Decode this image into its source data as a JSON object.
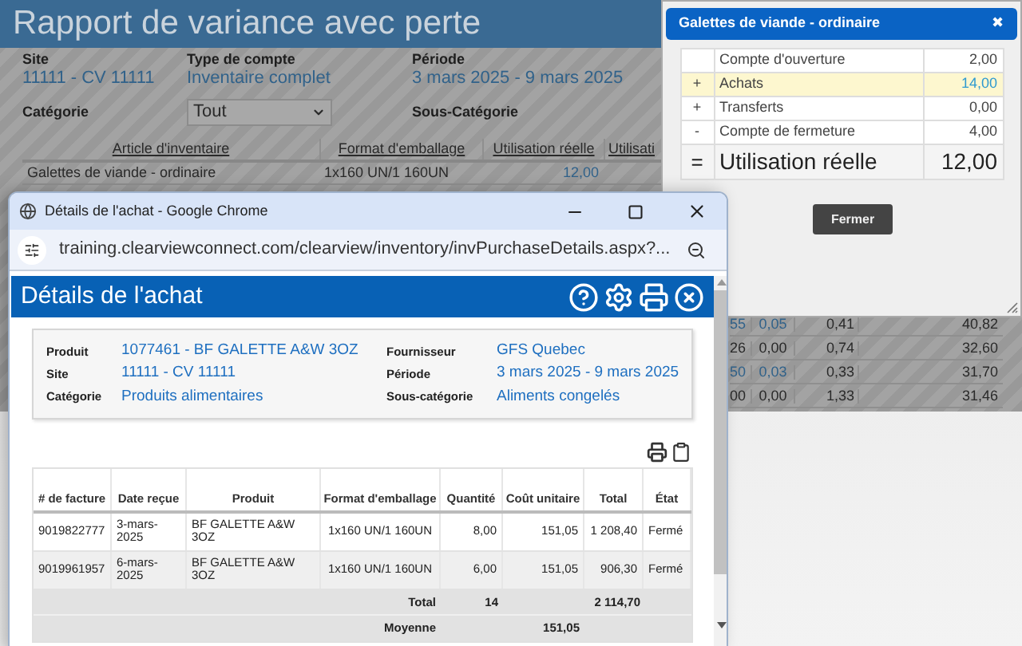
{
  "report": {
    "title": "Rapport de variance avec perte",
    "fields": [
      {
        "label": "Site",
        "value": "11111 - CV 11111"
      },
      {
        "label": "Type de compte",
        "value": "Inventaire complet"
      },
      {
        "label": "Période",
        "value": "3 mars 2025 - 9 mars 2025"
      }
    ],
    "category": {
      "label": "Catégorie",
      "value": "Tout"
    },
    "subcategory": {
      "label": "Sous-Catégorie"
    },
    "table": {
      "columns": [
        "Article d'inventaire",
        "Format d'emballage",
        "Utilisation réelle",
        "Utilisati"
      ],
      "rows": [
        {
          "item": "Galettes de viande - ordinaire",
          "format": "1x160 UN/1 160UN",
          "usage": "12,00"
        }
      ]
    },
    "lower_rows": [
      {
        "column_1": "55",
        "column_2": "0,05",
        "column_3": "0,41",
        "column_4": "40,82",
        "linked": true
      },
      {
        "column_1": "26",
        "column_2": "0,00",
        "column_3": "0,74",
        "column_4": "32,60",
        "linked": false
      },
      {
        "column_1": "50",
        "column_2": "0,03",
        "column_3": "0,33",
        "column_4": "31,70",
        "linked": true
      },
      {
        "column_1": "00",
        "column_2": "0,00",
        "column_3": "1,33",
        "column_4": "31,46",
        "linked": false
      }
    ]
  },
  "summary_dialog": {
    "title": "Galettes de viande - ordinaire",
    "close": "✖",
    "rows": [
      {
        "sign": "",
        "label": "Compte d'ouverture",
        "value": "2,00",
        "selected": false
      },
      {
        "sign": "+",
        "label": "Achats",
        "value": "14,00",
        "selected": true
      },
      {
        "sign": "+",
        "label": "Transferts",
        "value": "0,00",
        "selected": false
      },
      {
        "sign": "-",
        "label": "Compte de fermeture",
        "value": "4,00",
        "selected": false
      }
    ],
    "total": {
      "sign": "=",
      "label": "Utilisation réelle",
      "value": "12,00"
    },
    "button": "Fermer"
  },
  "browser_window": {
    "title": "Détails de l'achat - Google Chrome",
    "url": "training.clearviewconnect.com/clearview/inventory/invPurchaseDetails.aspx?...",
    "page": {
      "title": "Détails de l'achat",
      "info": [
        {
          "label": "Produit",
          "value": "1077461 - BF GALETTE A&W 3OZ"
        },
        {
          "label": "Fournisseur",
          "value": "GFS Quebec"
        },
        {
          "label": "Site",
          "value": "11111 - CV 11111"
        },
        {
          "label": "Période",
          "value": "3 mars 2025 - 9 mars 2025"
        },
        {
          "label": "Catégorie",
          "value": "Produits alimentaires"
        },
        {
          "label": "Sous-catégorie",
          "value": "Aliments congelés"
        }
      ],
      "table": {
        "columns": [
          "# de facture",
          "Date reçue",
          "Produit",
          "Format d'emballage",
          "Quantité",
          "Coût unitaire",
          "Total",
          "État"
        ],
        "rows": [
          [
            "9019822777",
            "3-mars-2025",
            "BF GALETTE A&W 3OZ",
            "1x160 UN/1 160UN",
            "8,00",
            "151,05",
            "1 208,40",
            "Fermé"
          ],
          [
            "9019961957",
            "6-mars-2025",
            "BF GALETTE A&W 3OZ",
            "1x160 UN/1 160UN",
            "6,00",
            "151,05",
            "906,30",
            "Fermé"
          ]
        ],
        "total": {
          "label": "Total",
          "quantity": "14",
          "total": "2 114,70"
        },
        "average": {
          "label": "Moyenne",
          "unit_cost": "151,05"
        }
      }
    }
  }
}
